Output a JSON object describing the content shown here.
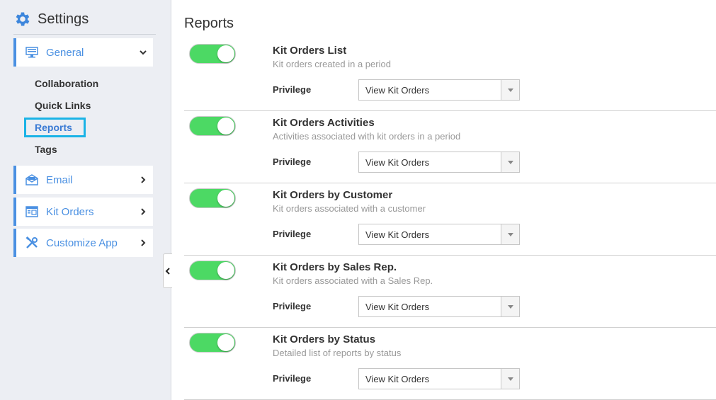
{
  "sidebar": {
    "header_title": "Settings",
    "menu": [
      {
        "label": "General",
        "icon": "monitor-icon",
        "expanded": true
      },
      {
        "label": "Email",
        "icon": "envelope-icon",
        "expanded": false
      },
      {
        "label": "Kit Orders",
        "icon": "window-list-icon",
        "expanded": false
      },
      {
        "label": "Customize App",
        "icon": "tools-icon",
        "expanded": false
      }
    ],
    "submenu": [
      {
        "label": "Collaboration"
      },
      {
        "label": "Quick Links"
      },
      {
        "label": "Reports",
        "active": true
      },
      {
        "label": "Tags"
      }
    ]
  },
  "main": {
    "title": "Reports",
    "privilege_label": "Privilege",
    "reports": [
      {
        "title": "Kit Orders List",
        "description": "Kit orders created in a period",
        "enabled": true,
        "privilege": "View Kit Orders"
      },
      {
        "title": "Kit Orders Activities",
        "description": "Activities associated with kit orders in a period",
        "enabled": true,
        "privilege": "View Kit Orders"
      },
      {
        "title": "Kit Orders by Customer",
        "description": "Kit orders associated with a customer",
        "enabled": true,
        "privilege": "View Kit Orders"
      },
      {
        "title": "Kit Orders by Sales Rep.",
        "description": "Kit orders associated with a Sales Rep.",
        "enabled": true,
        "privilege": "View Kit Orders"
      },
      {
        "title": "Kit Orders by Status",
        "description": "Detailed list of reports by status",
        "enabled": true,
        "privilege": "View Kit Orders"
      }
    ]
  },
  "colors": {
    "accent": "#4a90e2",
    "toggle_on": "#4cd964",
    "active_outline": "#1ab3e6"
  }
}
